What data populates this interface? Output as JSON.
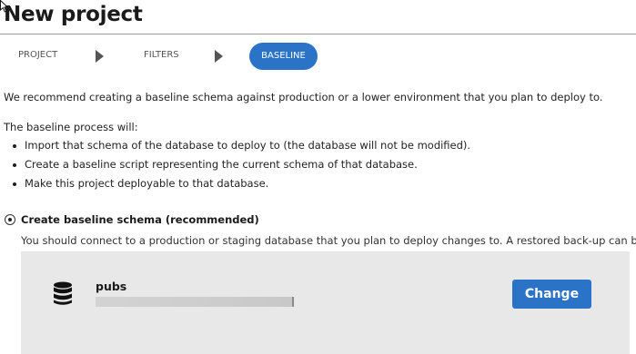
{
  "page": {
    "title": "New project"
  },
  "wizard": {
    "steps": [
      {
        "label": "PROJECT",
        "state": "inactive"
      },
      {
        "label": "FILTERS",
        "state": "inactive"
      },
      {
        "label": "BASELINE",
        "state": "active"
      }
    ],
    "active_color": "#2b73c6",
    "separator_icon": "chevron-right-icon"
  },
  "content": {
    "intro": "We recommend creating a baseline schema against production or a lower environment that you plan to deploy to.",
    "process_intro": "The baseline process will:",
    "bullets": [
      "Import that schema of the database to deploy to (the database will not be modified).",
      "Create a baseline script representing the current schema of that database.",
      "Make this project deployable to that database."
    ]
  },
  "baseline_option": {
    "label": "Create baseline schema (recommended)",
    "selected": true,
    "help_text": "You should connect to a production or staging database that you plan to deploy changes to. A restored back-up can be used."
  },
  "database": {
    "icon": "database-icon",
    "name": "pubs",
    "change_label": "Change",
    "button_color": "#2b73c6"
  }
}
